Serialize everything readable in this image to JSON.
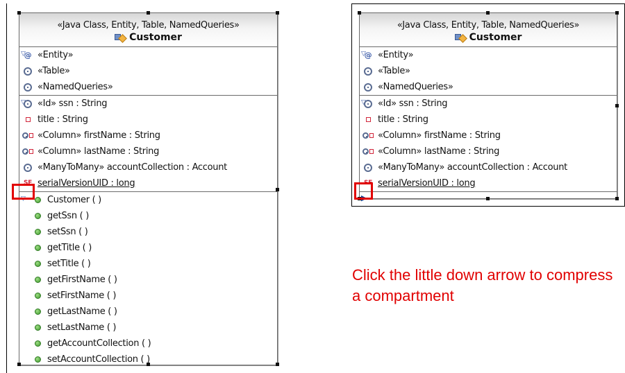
{
  "left_class": {
    "stereotypes": "«Java Class, Entity, Table, NamedQueries»",
    "name": "Customer",
    "annotations": [
      "«Entity»",
      "«Table»",
      "«NamedQueries»"
    ],
    "attributes": [
      "«Id» ssn : String",
      "title : String",
      "«Column» firstName : String",
      "«Column» lastName : String",
      "«ManyToMany» accountCollection : Account",
      "serialVersionUID : long"
    ],
    "operations": [
      "Customer ( )",
      "getSsn ( )",
      "setSsn ( )",
      "getTitle ( )",
      "setTitle ( )",
      "getFirstName ( )",
      "setFirstName ( )",
      "getLastName ( )",
      "setLastName ( )",
      "getAccountCollection ( )",
      "setAccountCollection ( )"
    ]
  },
  "right_class": {
    "stereotypes": "«Java Class, Entity, Table, NamedQueries»",
    "name": "Customer",
    "annotations": [
      "«Entity»",
      "«Table»",
      "«NamedQueries»"
    ],
    "attributes": [
      "«Id» ssn : String",
      "title : String",
      "«Column» firstName : String",
      "«Column» lastName : String",
      "«ManyToMany» accountCollection : Account",
      "serialVersionUID : long"
    ]
  },
  "caption": "Click the little down arrow to compress a compartment",
  "colors": {
    "highlight": "#e10000",
    "border": "#6a6a6a",
    "method_green": "#3f9a2c",
    "field_red": "#d1253a"
  },
  "icons": [
    "annotation-icon",
    "gear-icon",
    "field-icon",
    "method-icon",
    "static-final-icon",
    "class-icon",
    "collapse-arrow-icon",
    "expand-arrow-icon"
  ]
}
